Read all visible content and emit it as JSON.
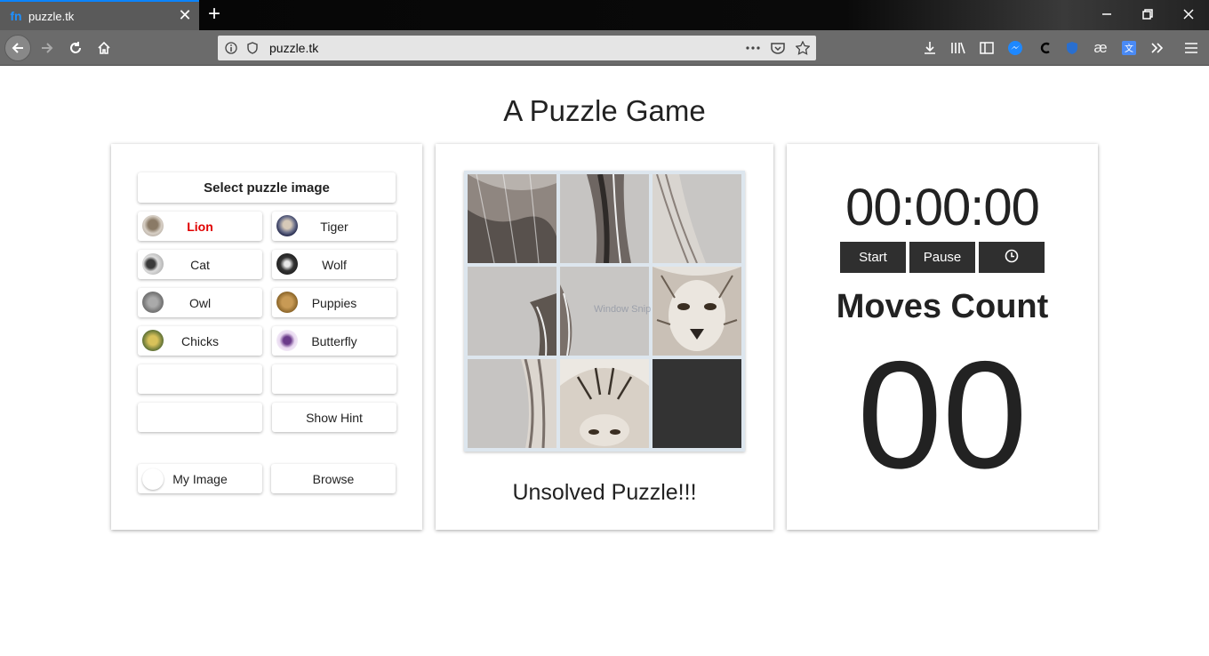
{
  "browser": {
    "tab_title": "puzzle.tk",
    "favicon": "fn",
    "url": "puzzle.tk",
    "tab_close": "✕",
    "new_tab": "+"
  },
  "page": {
    "title": "A Puzzle Game",
    "status": "Unsolved Puzzle!!!",
    "watermark": "Window Snip"
  },
  "selector": {
    "header": "Select puzzle image",
    "active": "Lion",
    "options": [
      {
        "label": "Lion",
        "icon": "lion-thumb"
      },
      {
        "label": "Tiger",
        "icon": "tiger-thumb"
      },
      {
        "label": "Cat",
        "icon": "cat-thumb"
      },
      {
        "label": "Wolf",
        "icon": "wolf-thumb"
      },
      {
        "label": "Owl",
        "icon": "owl-thumb"
      },
      {
        "label": "Puppies",
        "icon": "puppies-thumb"
      },
      {
        "label": "Chicks",
        "icon": "chicks-thumb"
      },
      {
        "label": "Butterfly",
        "icon": "butterfly-thumb"
      }
    ],
    "show_hint": "Show Hint",
    "my_image": "My Image",
    "browse": "Browse"
  },
  "timer": {
    "display": "00:00:00",
    "start": "Start",
    "pause": "Pause"
  },
  "moves": {
    "title": "Moves Count",
    "count": "00"
  },
  "colors": {
    "accent_red": "#e00000",
    "dark_button": "#2f2f2f",
    "empty_tile": "#333333",
    "tile_bg": "#c4c4c4"
  }
}
